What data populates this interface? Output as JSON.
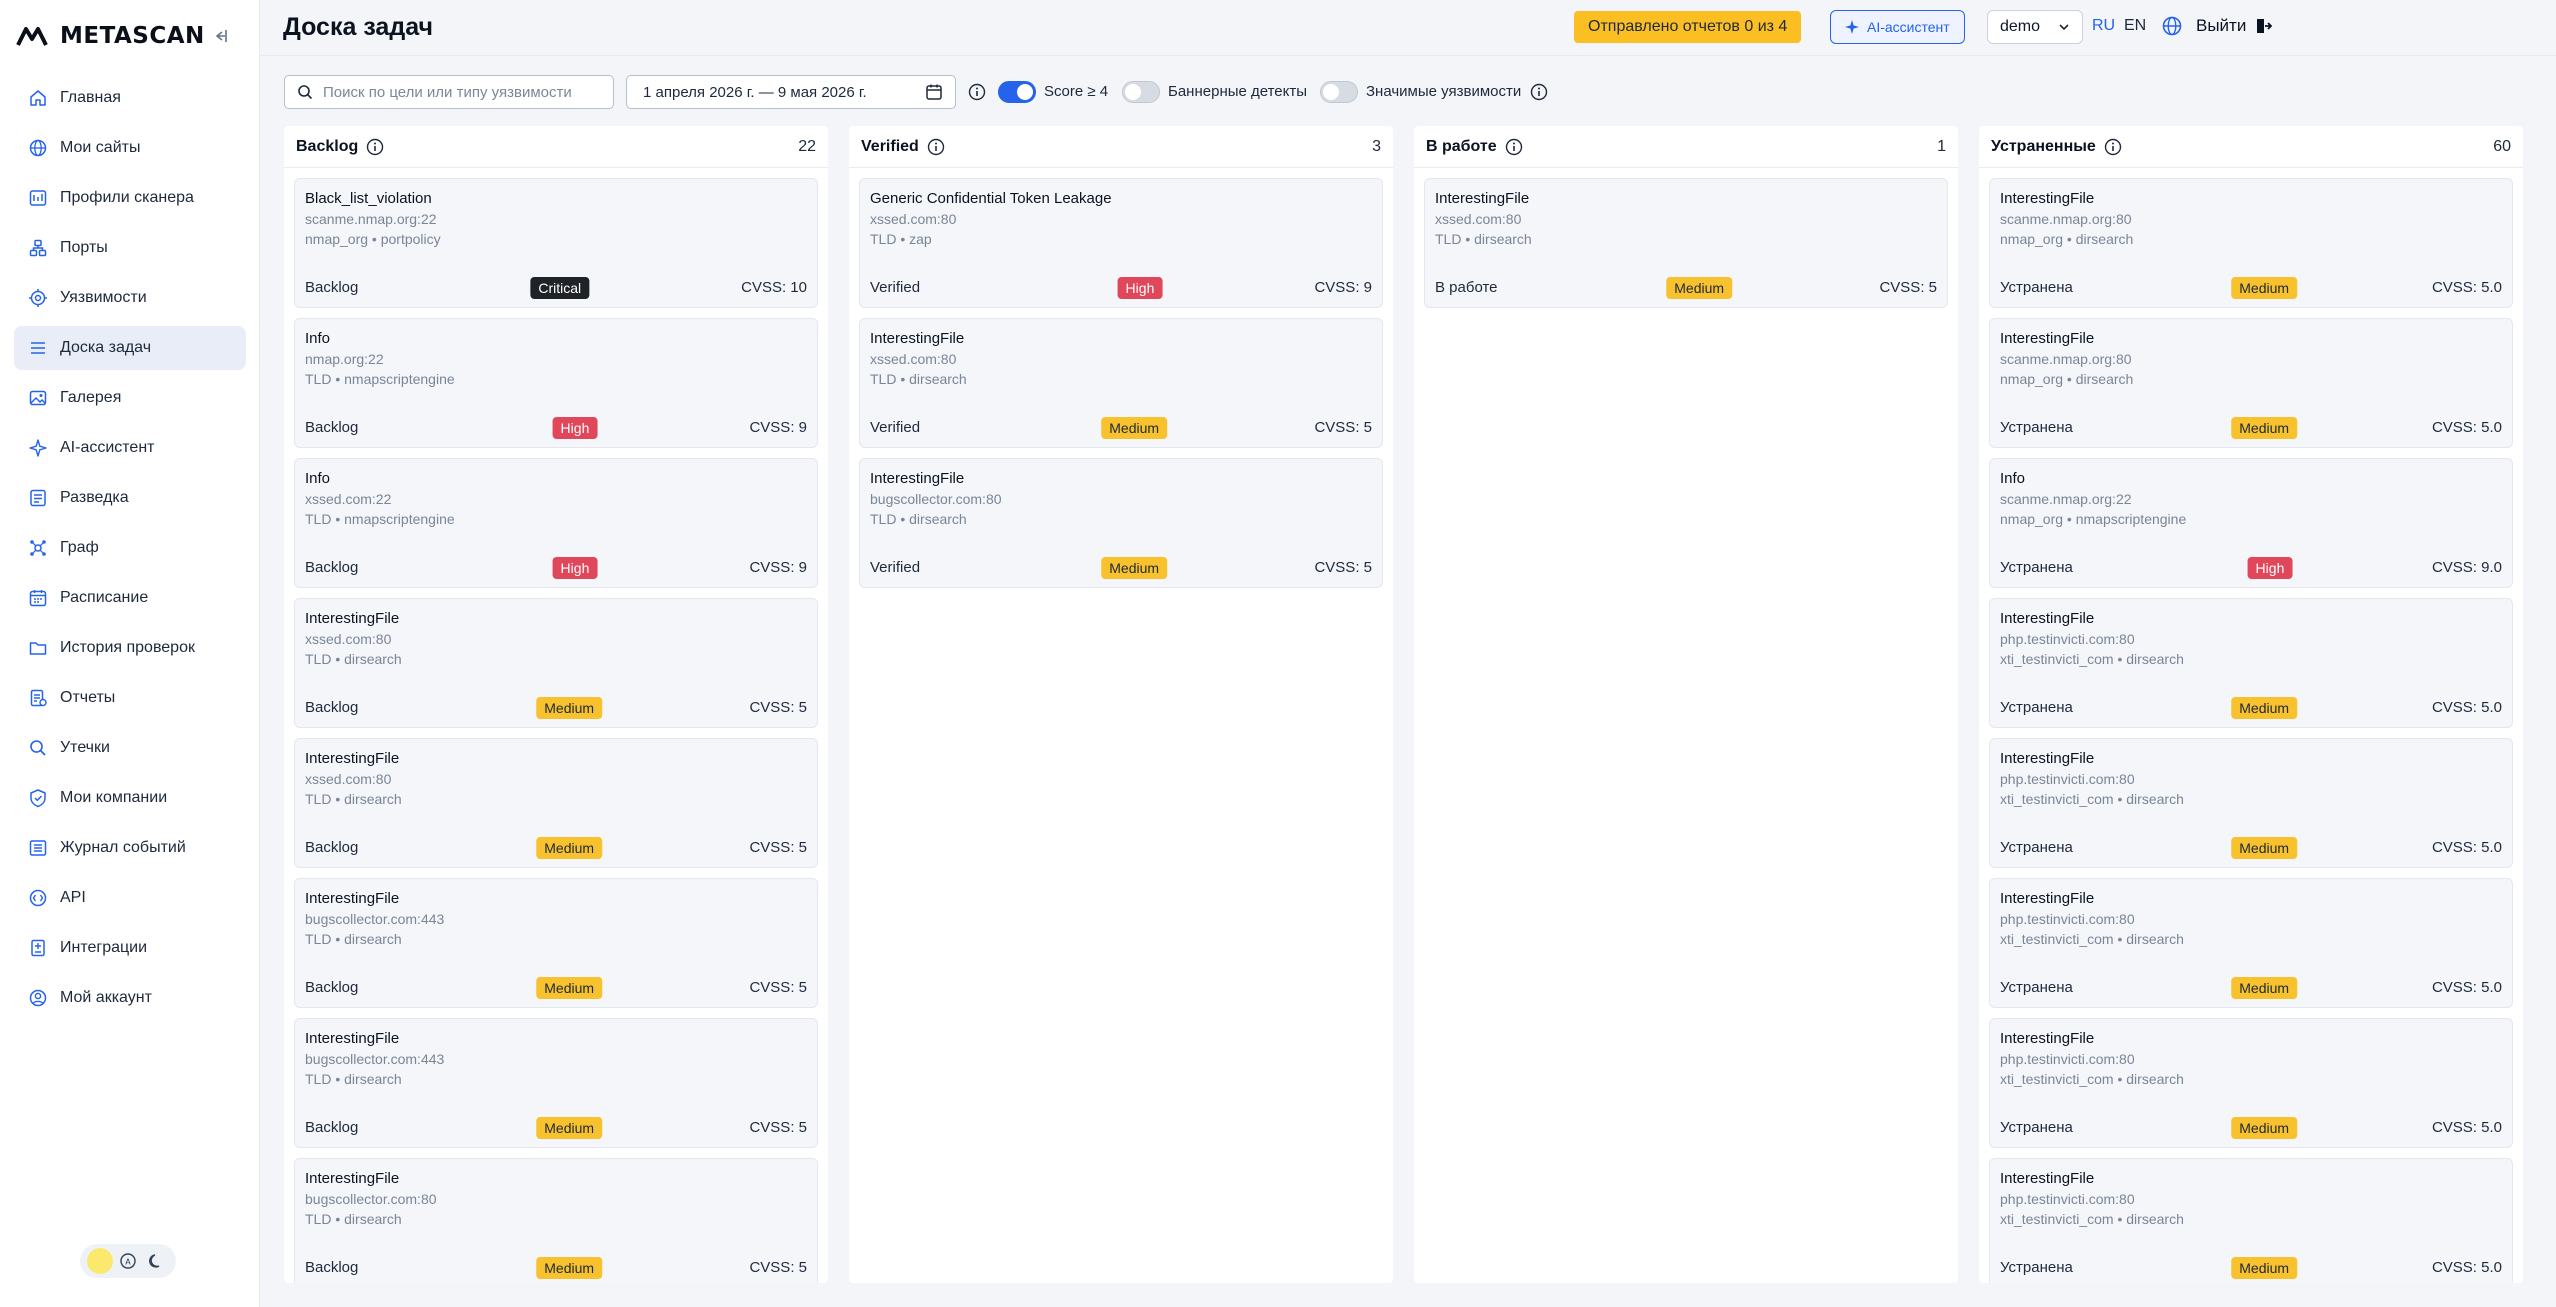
{
  "brand": {
    "name": "METASCAN"
  },
  "sidebar": {
    "items": [
      {
        "label": "Главная",
        "icon": "home-icon",
        "active": false
      },
      {
        "label": "Мои сайты",
        "icon": "globe-icon",
        "active": false
      },
      {
        "label": "Профили сканера",
        "icon": "scanner-profile-icon",
        "active": false
      },
      {
        "label": "Порты",
        "icon": "ports-icon",
        "active": false
      },
      {
        "label": "Уязвимости",
        "icon": "target-icon",
        "active": false
      },
      {
        "label": "Доска задач",
        "icon": "list-icon",
        "active": true
      },
      {
        "label": "Галерея",
        "icon": "image-icon",
        "active": false
      },
      {
        "label": "AI-ассистент",
        "icon": "sparkle-icon",
        "active": false
      },
      {
        "label": "Разведка",
        "icon": "recon-icon",
        "active": false
      },
      {
        "label": "Граф",
        "icon": "graph-icon",
        "active": false
      },
      {
        "label": "Расписание",
        "icon": "calendar-icon",
        "active": false
      },
      {
        "label": "История проверок",
        "icon": "folder-icon",
        "active": false
      },
      {
        "label": "Отчеты",
        "icon": "report-icon",
        "active": false
      },
      {
        "label": "Утечки",
        "icon": "search-icon",
        "active": false
      },
      {
        "label": "Мои компании",
        "icon": "shield-icon",
        "active": false
      },
      {
        "label": "Журнал событий",
        "icon": "log-icon",
        "active": false
      },
      {
        "label": "API",
        "icon": "api-icon",
        "active": false
      },
      {
        "label": "Интеграции",
        "icon": "integration-icon",
        "active": false
      },
      {
        "label": "Мой аккаунт",
        "icon": "user-icon",
        "active": false
      }
    ]
  },
  "header": {
    "title": "Доска задач",
    "reports_badge": "Отправлено отчетов 0 из 4",
    "ai_button": "AI-ассистент",
    "user": "demo",
    "lang_ru": "RU",
    "lang_en": "EN",
    "logout": "Выйти"
  },
  "filters": {
    "search_placeholder": "Поиск по цели или типу уязвимости",
    "date_range": "1 апреля 2026 г. — 9 мая 2026 г.",
    "toggles": [
      {
        "label": "Score ≥ 4",
        "on": true
      },
      {
        "label": "Баннерные детекты",
        "on": false
      },
      {
        "label": "Значимые уязвимости",
        "on": false
      }
    ]
  },
  "colors": {
    "accent": "#2563eb",
    "critical": "#1f2328",
    "high": "#e0475b",
    "medium": "#f8c12e",
    "reports_badge": "#fbbf24"
  },
  "columns": [
    {
      "title": "Backlog",
      "count": "22",
      "cards": [
        {
          "title": "Black_list_violation",
          "host": "scanme.nmap.org:22",
          "tags": "nmap_org • portpolicy",
          "status": "Backlog",
          "severity": "Critical",
          "cvss": "CVSS: 10"
        },
        {
          "title": "Info",
          "host": "nmap.org:22",
          "tags": "TLD • nmapscriptengine",
          "status": "Backlog",
          "severity": "High",
          "cvss": "CVSS: 9"
        },
        {
          "title": "Info",
          "host": "xssed.com:22",
          "tags": "TLD • nmapscriptengine",
          "status": "Backlog",
          "severity": "High",
          "cvss": "CVSS: 9"
        },
        {
          "title": "InterestingFile",
          "host": "xssed.com:80",
          "tags": "TLD • dirsearch",
          "status": "Backlog",
          "severity": "Medium",
          "cvss": "CVSS: 5"
        },
        {
          "title": "InterestingFile",
          "host": "xssed.com:80",
          "tags": "TLD • dirsearch",
          "status": "Backlog",
          "severity": "Medium",
          "cvss": "CVSS: 5"
        },
        {
          "title": "InterestingFile",
          "host": "bugscollector.com:443",
          "tags": "TLD • dirsearch",
          "status": "Backlog",
          "severity": "Medium",
          "cvss": "CVSS: 5"
        },
        {
          "title": "InterestingFile",
          "host": "bugscollector.com:443",
          "tags": "TLD • dirsearch",
          "status": "Backlog",
          "severity": "Medium",
          "cvss": "CVSS: 5"
        },
        {
          "title": "InterestingFile",
          "host": "bugscollector.com:80",
          "tags": "TLD • dirsearch",
          "status": "Backlog",
          "severity": "Medium",
          "cvss": "CVSS: 5"
        }
      ]
    },
    {
      "title": "Verified",
      "count": "3",
      "cards": [
        {
          "title": "Generic Confidential Token Leakage",
          "host": "xssed.com:80",
          "tags": "TLD • zap",
          "status": "Verified",
          "severity": "High",
          "cvss": "CVSS: 9"
        },
        {
          "title": "InterestingFile",
          "host": "xssed.com:80",
          "tags": "TLD • dirsearch",
          "status": "Verified",
          "severity": "Medium",
          "cvss": "CVSS: 5"
        },
        {
          "title": "InterestingFile",
          "host": "bugscollector.com:80",
          "tags": "TLD • dirsearch",
          "status": "Verified",
          "severity": "Medium",
          "cvss": "CVSS: 5"
        }
      ]
    },
    {
      "title": "В работе",
      "count": "1",
      "cards": [
        {
          "title": "InterestingFile",
          "host": "xssed.com:80",
          "tags": "TLD • dirsearch",
          "status": "В работе",
          "severity": "Medium",
          "cvss": "CVSS: 5"
        }
      ]
    },
    {
      "title": "Устраненные",
      "count": "60",
      "cards": [
        {
          "title": "InterestingFile",
          "host": "scanme.nmap.org:80",
          "tags": "nmap_org • dirsearch",
          "status": "Устранена",
          "severity": "Medium",
          "cvss": "CVSS: 5.0"
        },
        {
          "title": "InterestingFile",
          "host": "scanme.nmap.org:80",
          "tags": "nmap_org • dirsearch",
          "status": "Устранена",
          "severity": "Medium",
          "cvss": "CVSS: 5.0"
        },
        {
          "title": "Info",
          "host": "scanme.nmap.org:22",
          "tags": "nmap_org • nmapscriptengine",
          "status": "Устранена",
          "severity": "High",
          "cvss": "CVSS: 9.0"
        },
        {
          "title": "InterestingFile",
          "host": "php.testinvicti.com:80",
          "tags": "xti_testinvicti_com • dirsearch",
          "status": "Устранена",
          "severity": "Medium",
          "cvss": "CVSS: 5.0"
        },
        {
          "title": "InterestingFile",
          "host": "php.testinvicti.com:80",
          "tags": "xti_testinvicti_com • dirsearch",
          "status": "Устранена",
          "severity": "Medium",
          "cvss": "CVSS: 5.0"
        },
        {
          "title": "InterestingFile",
          "host": "php.testinvicti.com:80",
          "tags": "xti_testinvicti_com • dirsearch",
          "status": "Устранена",
          "severity": "Medium",
          "cvss": "CVSS: 5.0"
        },
        {
          "title": "InterestingFile",
          "host": "php.testinvicti.com:80",
          "tags": "xti_testinvicti_com • dirsearch",
          "status": "Устранена",
          "severity": "Medium",
          "cvss": "CVSS: 5.0"
        },
        {
          "title": "InterestingFile",
          "host": "php.testinvicti.com:80",
          "tags": "xti_testinvicti_com • dirsearch",
          "status": "Устранена",
          "severity": "Medium",
          "cvss": "CVSS: 5.0"
        }
      ]
    }
  ]
}
